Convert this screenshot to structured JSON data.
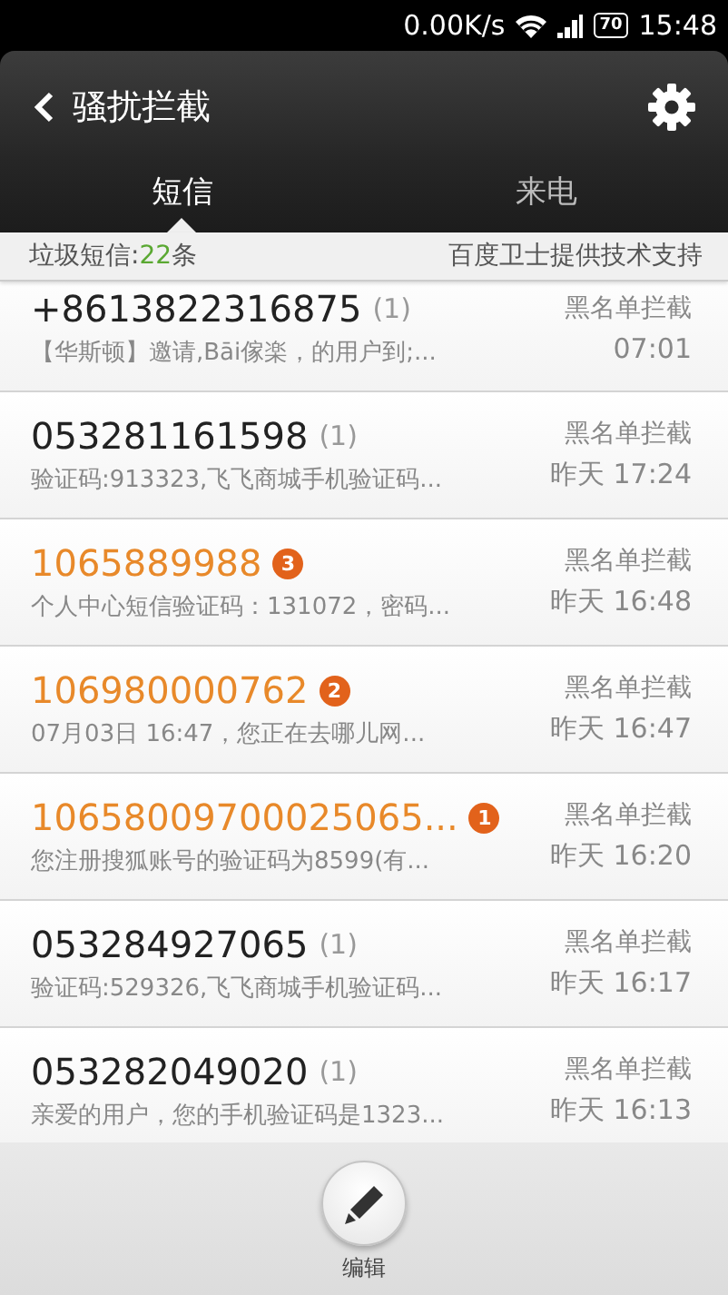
{
  "status_bar": {
    "speed": "0.00K/s",
    "battery": "70",
    "time": "15:48"
  },
  "header": {
    "title": "骚扰拦截"
  },
  "tabs": [
    {
      "label": "短信",
      "selected": true
    },
    {
      "label": "来电",
      "selected": false
    }
  ],
  "info_bar": {
    "spam_label": "垃圾短信:",
    "spam_count": "22",
    "spam_unit": "条",
    "provider": "百度卫士提供技术支持"
  },
  "messages": [
    {
      "sender": "+8613822316875",
      "unread": false,
      "count": "(1)",
      "preview": "【华斯顿】邀请,Bāi傢楽，的用户到;...",
      "tag": "黑名单拦截",
      "time": "07:01"
    },
    {
      "sender": "053281161598",
      "unread": false,
      "count": "(1)",
      "preview": "验证码:913323,飞飞商城手机验证码...",
      "tag": "黑名单拦截",
      "time": "昨天 17:24"
    },
    {
      "sender": "1065889988",
      "unread": true,
      "count": "3",
      "preview": "个人中心短信验证码：131072，密码...",
      "tag": "黑名单拦截",
      "time": "昨天 16:48"
    },
    {
      "sender": "106980000762",
      "unread": true,
      "count": "2",
      "preview": "07月03日 16:47，您正在去哪儿网...",
      "tag": "黑名单拦截",
      "time": "昨天 16:47"
    },
    {
      "sender": "10658009700025065...",
      "unread": true,
      "count": "1",
      "preview": "您注册搜狐账号的验证码为8599(有...",
      "tag": "黑名单拦截",
      "time": "昨天 16:20"
    },
    {
      "sender": "053284927065",
      "unread": false,
      "count": "(1)",
      "preview": "验证码:529326,飞飞商城手机验证码...",
      "tag": "黑名单拦截",
      "time": "昨天 16:17"
    },
    {
      "sender": "053282049020",
      "unread": false,
      "count": "(1)",
      "preview": "亲爱的用户，您的手机验证码是1323...",
      "tag": "黑名单拦截",
      "time": "昨天 16:13"
    }
  ],
  "bottom_bar": {
    "edit_label": "编辑"
  }
}
